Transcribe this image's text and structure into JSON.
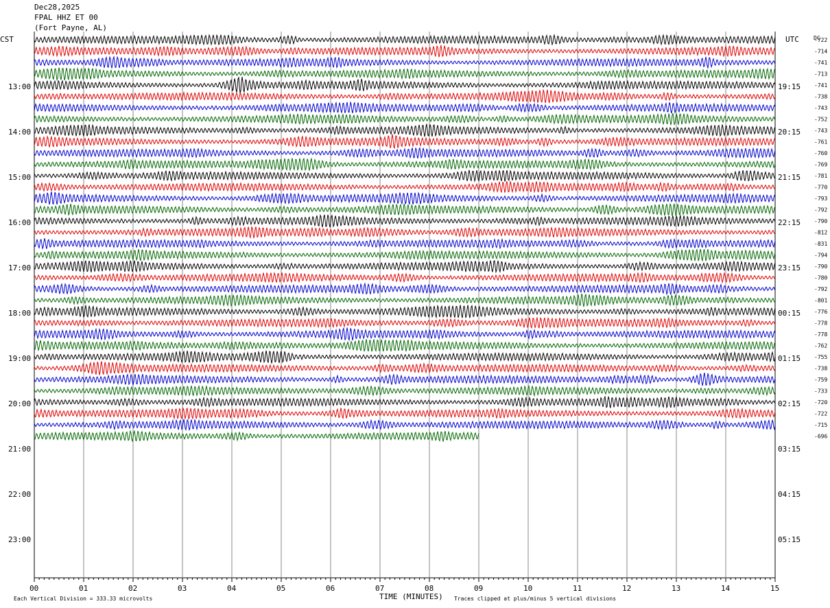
{
  "header": {
    "date": "Dec28,2025",
    "station": "FPAL HHZ ET 00",
    "location": "(Fort Payne, AL)"
  },
  "left_tz": "CST",
  "right_tz": "UTC",
  "dc_label": "DC",
  "footer": {
    "division": "Each Vertical Division =  333.33 microvolts",
    "xlabel": "TIME (MINUTES)",
    "clip": "Traces clipped at plus/minus 5 vertical divisions"
  },
  "chart_data": {
    "type": "line",
    "title": "FPAL HHZ ET 00",
    "xlabel": "TIME (MINUTES)",
    "xlim": [
      0,
      15
    ],
    "x_ticks": [
      "00",
      "01",
      "02",
      "03",
      "04",
      "05",
      "06",
      "07",
      "08",
      "09",
      "10",
      "11",
      "12",
      "13",
      "14",
      "15"
    ],
    "hour_labels_left": [
      "13:00",
      "14:00",
      "15:00",
      "16:00",
      "17:00",
      "18:00",
      "19:00",
      "20:00",
      "21:00",
      "22:00",
      "23:00"
    ],
    "hour_labels_right": [
      "19:15",
      "20:15",
      "21:15",
      "22:15",
      "23:15",
      "00:15",
      "01:15",
      "02:15",
      "03:15",
      "04:15",
      "05:15"
    ],
    "trace_colors": [
      "#000000",
      "#dd0000",
      "#0000cc",
      "#006600"
    ],
    "dc_offsets": [
      -722,
      -714,
      -741,
      -713,
      -741,
      -738,
      -743,
      -752,
      -743,
      -761,
      -760,
      -769,
      -781,
      -770,
      -793,
      -792,
      -790,
      -812,
      -831,
      -794,
      -790,
      -780,
      -792,
      -801,
      -776,
      -778,
      -778,
      -762,
      -755,
      -738,
      -759,
      -733,
      -720,
      -722,
      -715,
      -696
    ],
    "last_trace_end_minute": 9,
    "units": "microvolts",
    "division_value": 333.33,
    "clip_divisions": 5
  }
}
